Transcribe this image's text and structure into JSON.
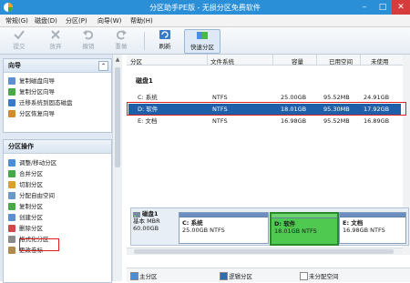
{
  "window": {
    "title": "分区助手PE版 - 无损分区免费软件"
  },
  "menu": [
    "常规(G)",
    "磁盘(D)",
    "分区(P)",
    "向导(W)",
    "帮助(H)"
  ],
  "toolbar": [
    {
      "label": "提交",
      "icon": "check-icon",
      "enabled": false
    },
    {
      "label": "放弃",
      "icon": "discard-icon",
      "enabled": false
    },
    {
      "label": "撤销",
      "icon": "undo-icon",
      "enabled": false
    },
    {
      "label": "重做",
      "icon": "redo-icon",
      "enabled": false
    },
    {
      "label": "刷新",
      "icon": "refresh-icon",
      "enabled": true
    },
    {
      "label": "快速分区",
      "icon": "quick-partition-icon",
      "enabled": true
    }
  ],
  "wizard_panel": {
    "title": "向导",
    "items": [
      "复制磁盘向导",
      "复制分区向导",
      "迁移系统到固态磁盘",
      "分区恢复向导"
    ]
  },
  "ops_panel": {
    "title": "分区操作",
    "items": [
      "调整/移动分区",
      "合并分区",
      "切割分区",
      "分配自由空间",
      "复制分区",
      "创建分区",
      "删除分区",
      "格式化分区",
      "更改卷标"
    ]
  },
  "table": {
    "headers": [
      "分区",
      "文件系统",
      "容量",
      "已用空间",
      "未使用"
    ],
    "disk_label": "磁盘1",
    "rows": [
      {
        "name": "C: 系统",
        "fs": "NTFS",
        "capacity": "25.00GB",
        "used": "95.52MB",
        "free": "24.91GB",
        "selected": false
      },
      {
        "name": "D: 软件",
        "fs": "NTFS",
        "capacity": "18.01GB",
        "used": "95.30MB",
        "free": "17.92GB",
        "selected": true
      },
      {
        "name": "E: 文档",
        "fs": "NTFS",
        "capacity": "16.98GB",
        "used": "95.52MB",
        "free": "16.89GB",
        "selected": false
      }
    ]
  },
  "diskmap": {
    "disk_name": "磁盘1",
    "disk_type": "基本 MBR",
    "disk_size": "60.00GB",
    "partitions": [
      {
        "name": "C: 系统",
        "info": "25.00GB NTFS",
        "selected": false
      },
      {
        "name": "D: 软件",
        "info": "18.01GB NTFS",
        "selected": true
      },
      {
        "name": "E: 文档",
        "info": "16.98GB NTFS",
        "selected": false
      }
    ]
  },
  "legend": [
    {
      "label": "主分区",
      "color": "#4a8fd8"
    },
    {
      "label": "逻辑分区",
      "color": "#2d6bb3"
    },
    {
      "label": "未分配空间",
      "color": "#ffffff"
    }
  ]
}
